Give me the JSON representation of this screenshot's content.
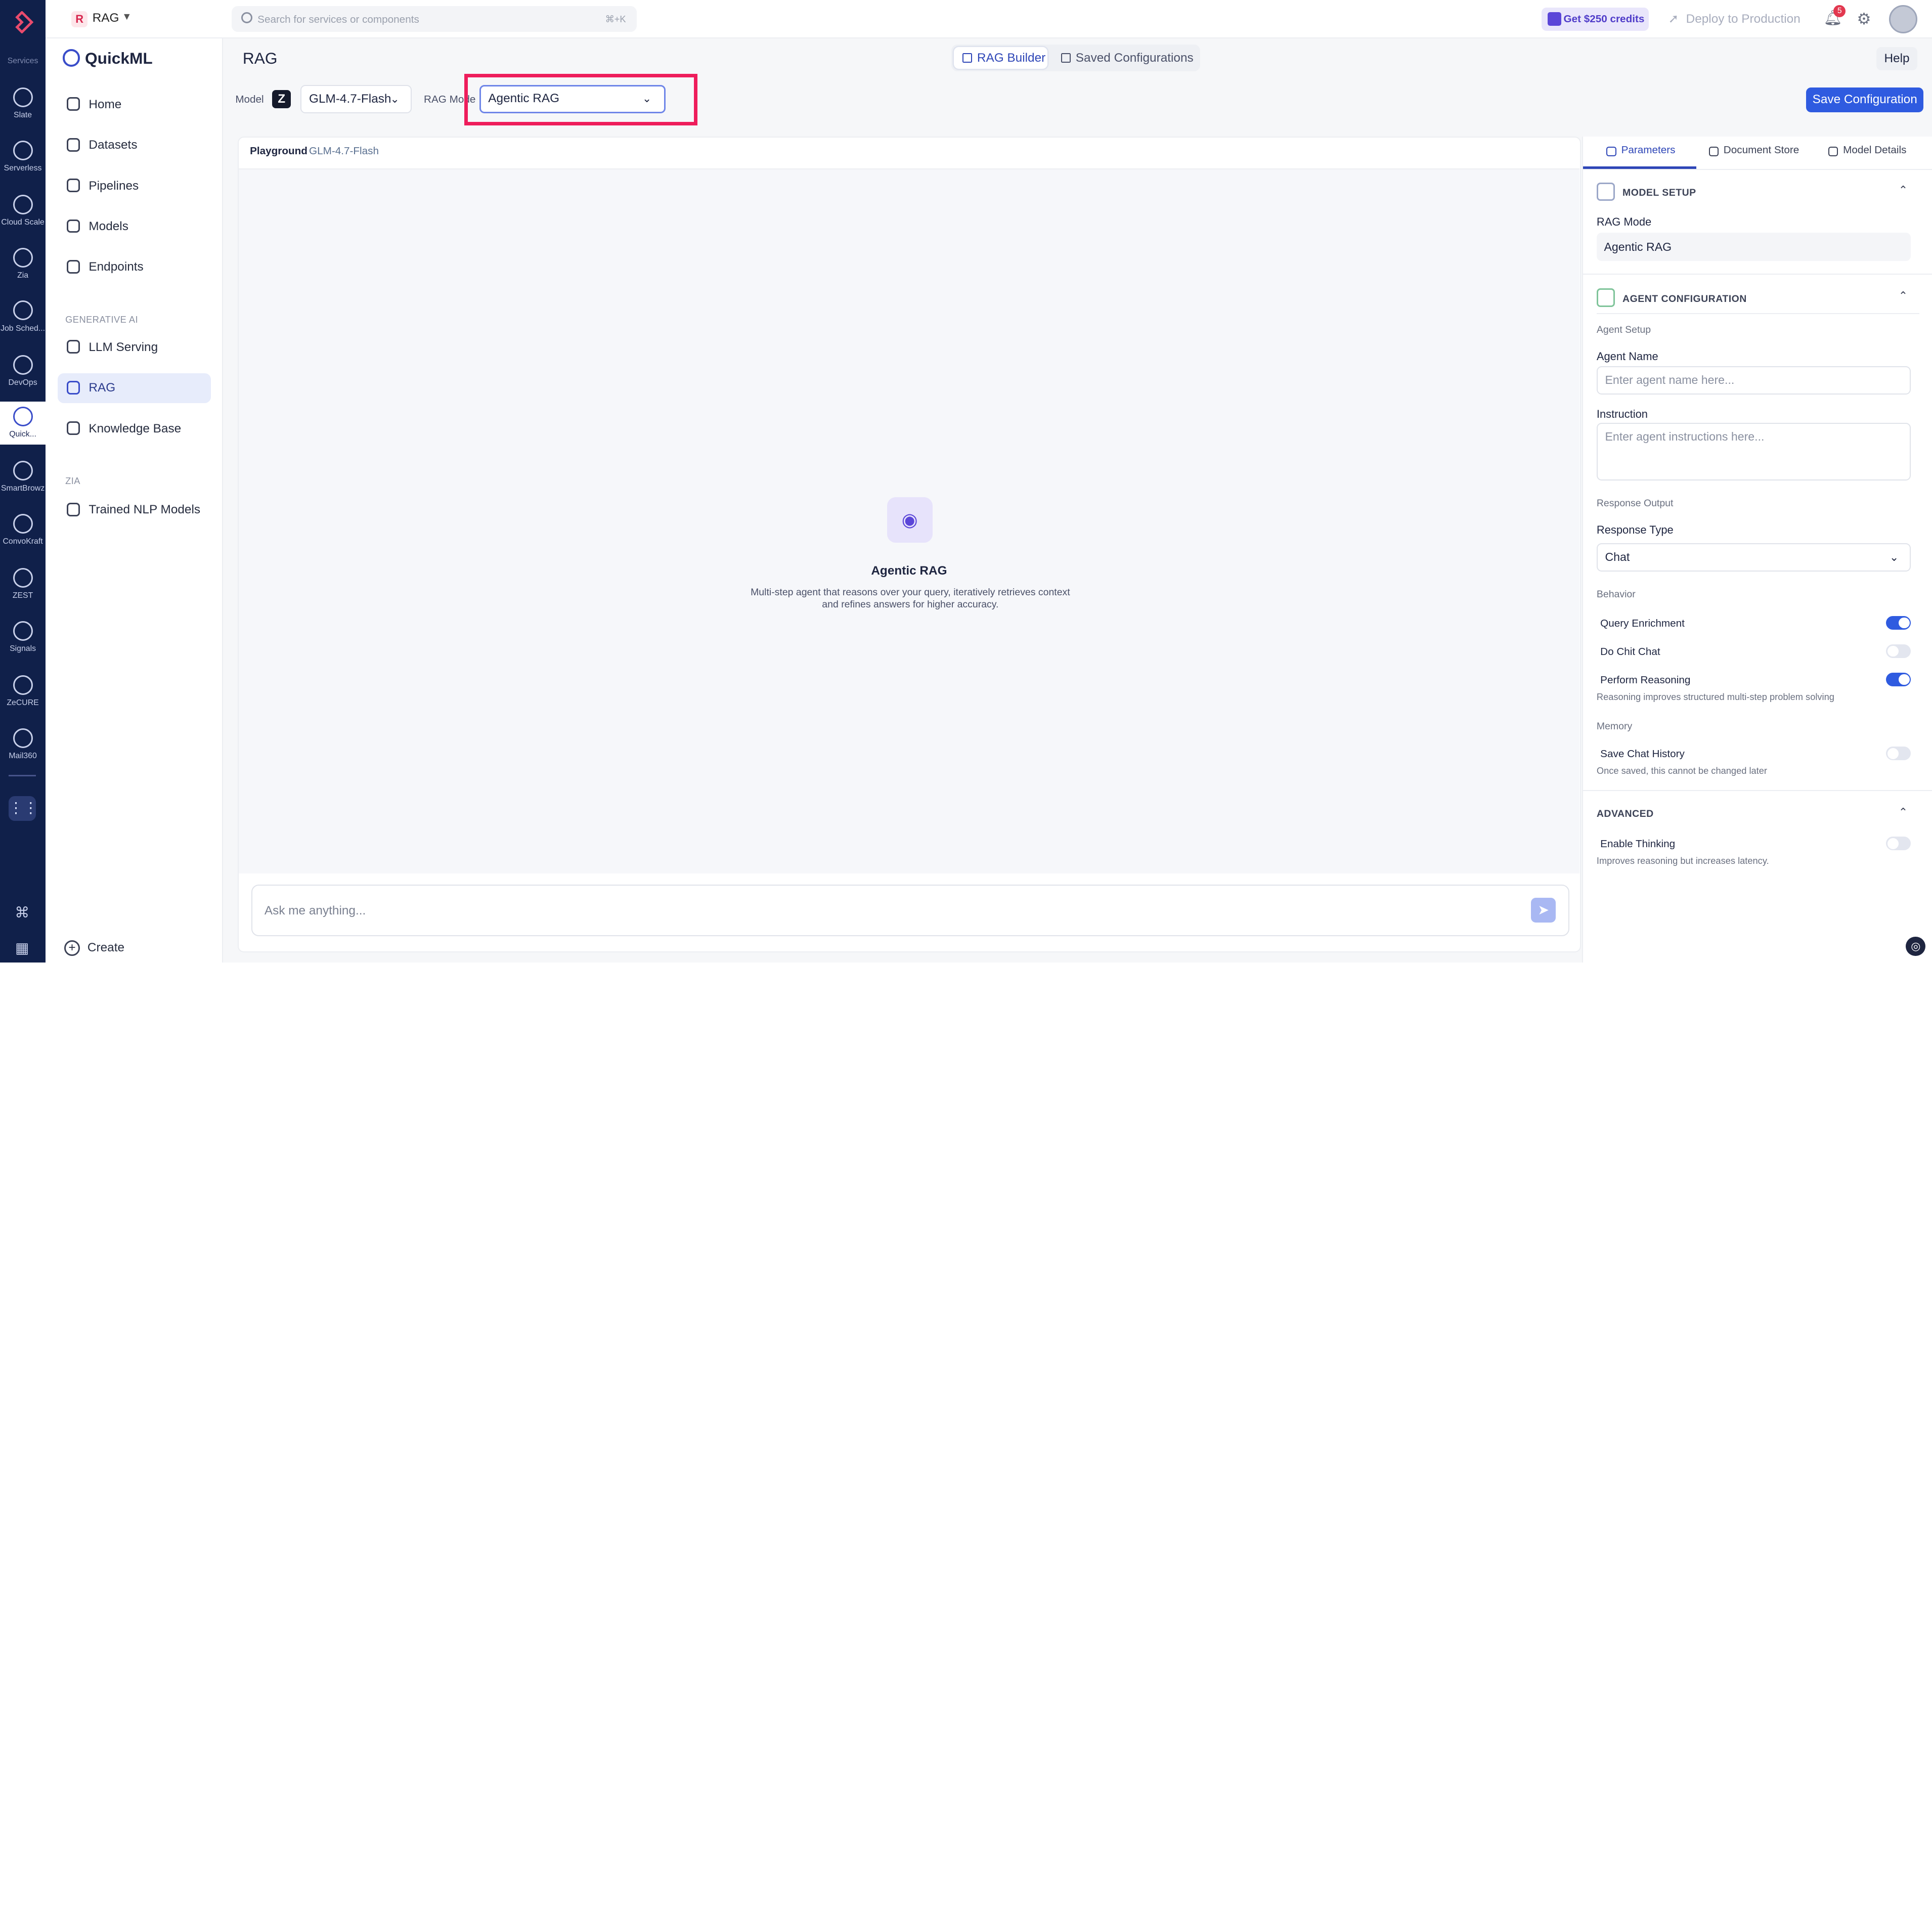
{
  "topbar": {
    "project_badge": "R",
    "project_name": "RAG",
    "search_placeholder": "Search for services or components",
    "search_shortcut": "⌘+K",
    "credits_label": "Get $250 credits",
    "deploy_label": "Deploy to Production",
    "notification_count": "5"
  },
  "rail": {
    "services_label": "Services",
    "items": [
      {
        "label": "Slate"
      },
      {
        "label": "Serverless"
      },
      {
        "label": "Cloud Scale"
      },
      {
        "label": "Zia"
      },
      {
        "label": "Job Sched..."
      },
      {
        "label": "DevOps"
      },
      {
        "label": "Quick..."
      },
      {
        "label": "SmartBrowz"
      },
      {
        "label": "ConvoKraft"
      },
      {
        "label": "ZEST"
      },
      {
        "label": "Signals"
      },
      {
        "label": "ZeCURE"
      },
      {
        "label": "Mail360"
      }
    ]
  },
  "sidebar": {
    "brand": "QuickML",
    "items": [
      {
        "label": "Home"
      },
      {
        "label": "Datasets"
      },
      {
        "label": "Pipelines"
      },
      {
        "label": "Models"
      },
      {
        "label": "Endpoints"
      }
    ],
    "group_generative": "GENERATIVE AI",
    "gen_items": [
      {
        "label": "LLM Serving"
      },
      {
        "label": "RAG"
      },
      {
        "label": "Knowledge Base"
      }
    ],
    "group_zia": "ZIA",
    "zia_items": [
      {
        "label": "Trained NLP Models"
      }
    ],
    "create_label": "Create"
  },
  "header": {
    "title": "RAG",
    "tab_builder": "RAG Builder",
    "tab_saved": "Saved Configurations",
    "help": "Help",
    "model_label": "Model",
    "model_logo": "Z",
    "model_value": "GLM-4.7-Flash",
    "rag_mode_label": "RAG Mode",
    "rag_mode_value": "Agentic RAG",
    "save_label": "Save Configuration"
  },
  "playground": {
    "title": "Playground",
    "model": "GLM-4.7-Flash",
    "empty_title": "Agentic RAG",
    "empty_desc": "Multi-step agent that reasons over your query, iteratively retrieves context and refines answers for higher accuracy.",
    "input_placeholder": "Ask me anything..."
  },
  "panel": {
    "tabs": [
      {
        "label": "Parameters"
      },
      {
        "label": "Document Store"
      },
      {
        "label": "Model Details"
      }
    ],
    "model_setup_title": "MODEL SETUP",
    "rag_mode_label": "RAG Mode",
    "rag_mode_value": "Agentic RAG",
    "agent_config_title": "AGENT CONFIGURATION",
    "agent_setup_label": "Agent Setup",
    "agent_name_label": "Agent Name",
    "agent_name_placeholder": "Enter agent name here...",
    "instruction_label": "Instruction",
    "instruction_placeholder": "Enter agent instructions here...",
    "response_output_label": "Response Output",
    "response_type_label": "Response Type",
    "response_type_value": "Chat",
    "behavior_label": "Behavior",
    "query_enrichment": {
      "label": "Query Enrichment",
      "on": true
    },
    "do_chit_chat": {
      "label": "Do Chit Chat",
      "on": false
    },
    "perform_reasoning": {
      "label": "Perform Reasoning",
      "on": true,
      "help": "Reasoning improves structured multi-step problem solving"
    },
    "memory_label": "Memory",
    "save_chat_history": {
      "label": "Save Chat History",
      "on": false,
      "help": "Once saved, this cannot be changed later"
    },
    "advanced_title": "ADVANCED",
    "enable_thinking": {
      "label": "Enable Thinking",
      "on": false,
      "help": "Improves reasoning but increases latency."
    }
  },
  "colors": {
    "rail_bg": "#10204a",
    "accent": "#2f5be0",
    "highlight_box": "#ee1d5c"
  }
}
